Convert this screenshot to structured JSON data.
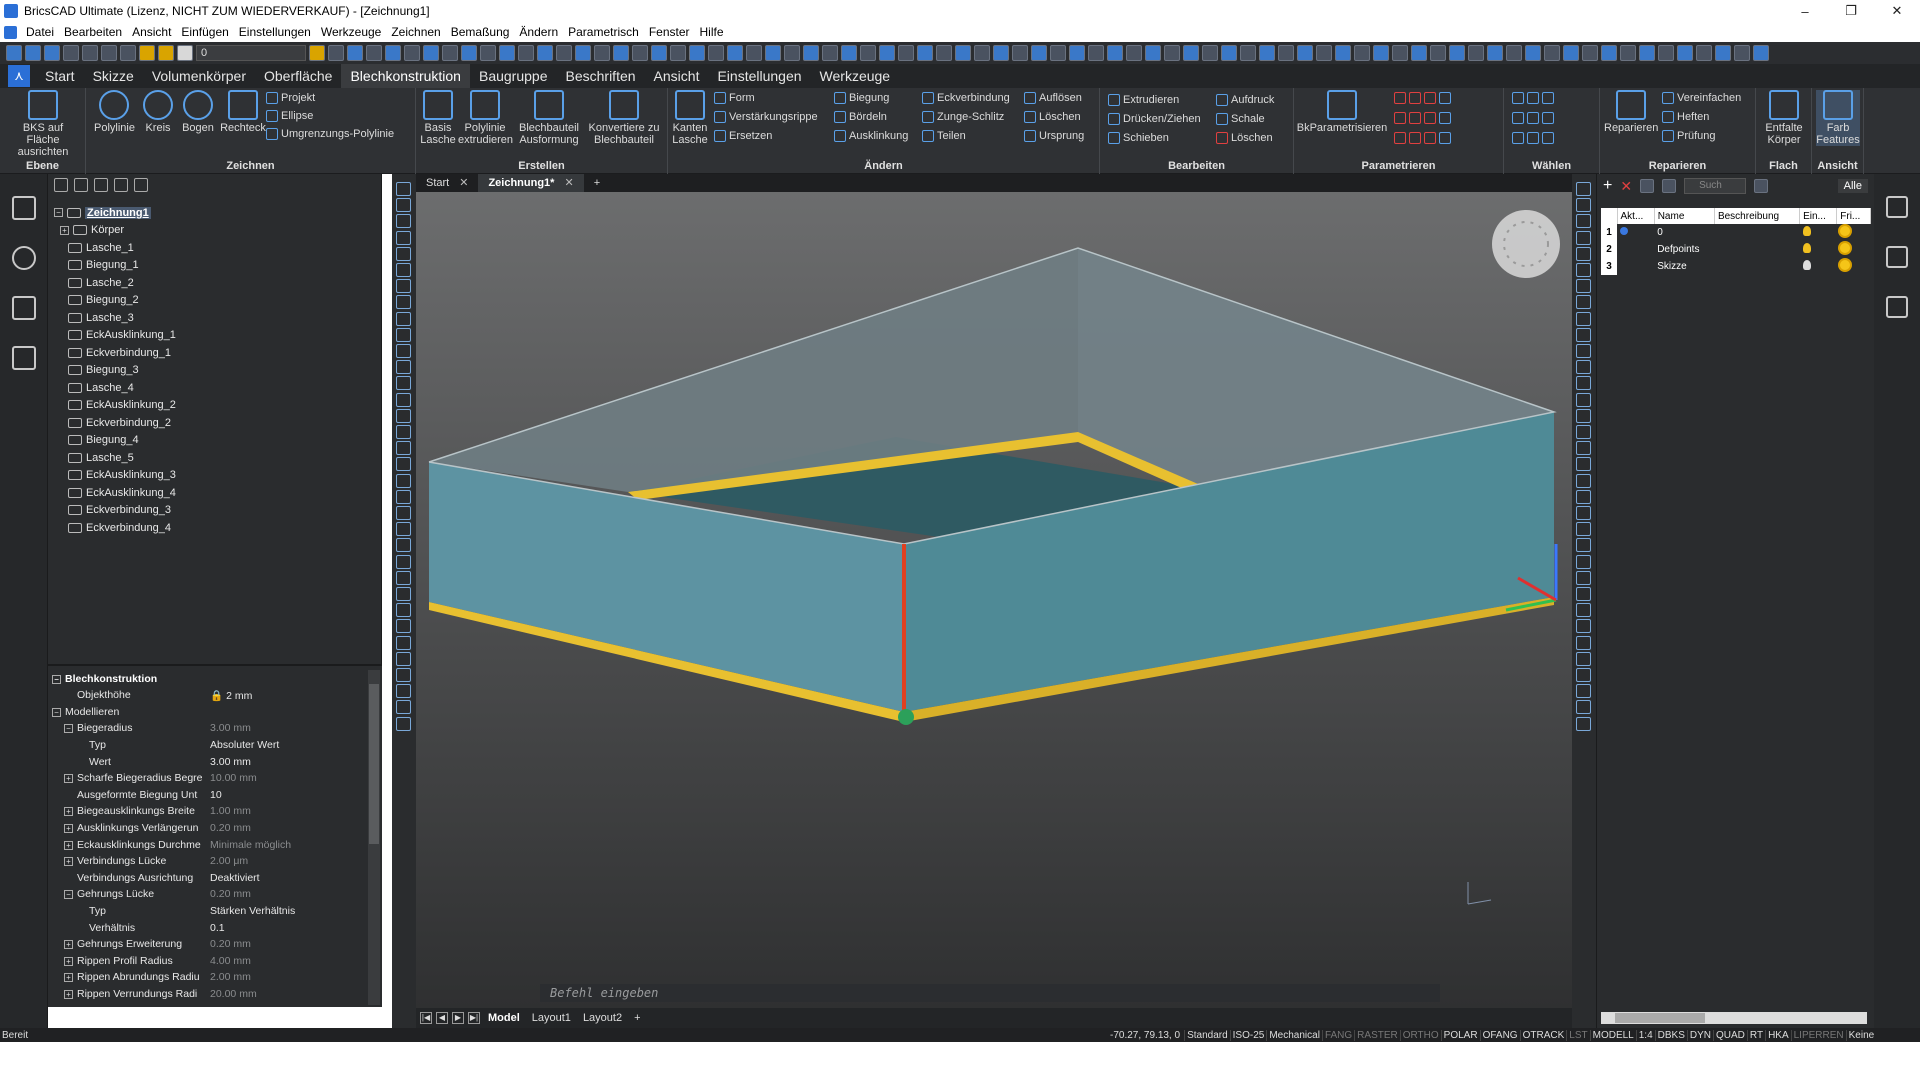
{
  "window": {
    "title": "BricsCAD Ultimate (Lizenz, NICHT ZUM WIEDERVERKAUF) - [Zeichnung1]",
    "controls": [
      "–",
      "❐",
      "✕"
    ]
  },
  "menu": [
    "Datei",
    "Bearbeiten",
    "Ansicht",
    "Einfügen",
    "Einstellungen",
    "Werkzeuge",
    "Zeichnen",
    "Bemaßung",
    "Ändern",
    "Parametrisch",
    "Fenster",
    "Hilfe"
  ],
  "quick_access": {
    "current_layer": "0"
  },
  "ribbon_tabs": [
    "Start",
    "Skizze",
    "Volumenkörper",
    "Oberfläche",
    "Blechkonstruktion",
    "Baugruppe",
    "Beschriften",
    "Ansicht",
    "Einstellungen",
    "Werkzeuge"
  ],
  "active_ribbon_tab": "Blechkonstruktion",
  "ribbon": {
    "ebene": {
      "label": "Ebene",
      "bks": "BKS auf Fläche ausrichten"
    },
    "zeichnen": {
      "label": "Zeichnen",
      "polylinie": "Polylinie",
      "kreis": "Kreis",
      "bogen": "Bogen",
      "rechteck": "Rechteck",
      "projekt": "Projekt",
      "ellipse": "Ellipse",
      "umgrenzung": "Umgrenzungs-Polylinie"
    },
    "erstellen": {
      "label": "Erstellen",
      "basis_lasche": "Basis Lasche",
      "polylinie_extrudieren": "Polylinie extrudieren",
      "blechbauteil_ausformung": "Blechbauteil Ausformung",
      "konvertiere": "Konvertiere zu Blechbauteil"
    },
    "aendern": {
      "label": "Ändern",
      "kanten_lasche": "Kanten Lasche",
      "form": "Form",
      "verstaerkungsrippe": "Verstärkungsrippe",
      "ersetzen": "Ersetzen",
      "biegung": "Biegung",
      "boerdeln": "Bördeln",
      "ausklinkung": "Ausklinkung",
      "eckverbindung": "Eckverbindung",
      "zunge_schlitz": "Zunge-Schlitz",
      "teilen": "Teilen",
      "aufloesen": "Auflösen",
      "loeschen": "Löschen",
      "ursprung": "Ursprung"
    },
    "bearbeiten": {
      "label": "Bearbeiten",
      "extrudieren": "Extrudieren",
      "druecken_ziehen": "Drücken/Ziehen",
      "schieben": "Schieben",
      "aufdruck": "Aufdruck",
      "schale": "Schale",
      "loeschen": "Löschen"
    },
    "parametrieren": {
      "label": "Parametrieren",
      "bkparametrisieren": "BkParametrisieren"
    },
    "waehlen": {
      "label": "Wählen"
    },
    "reparieren": {
      "label": "Reparieren",
      "reparieren": "Reparieren",
      "vereinfachen": "Vereinfachen",
      "heften": "Heften",
      "pruefung": "Prüfung"
    },
    "flach": {
      "label": "Flach",
      "entfalte": "Entfalte Körper"
    },
    "ansicht": {
      "label": "Ansicht",
      "farb": "Farb Features"
    }
  },
  "doc_tabs": [
    {
      "label": "Start",
      "active": false
    },
    {
      "label": "Zeichnung1*",
      "active": true
    }
  ],
  "structure_tree": {
    "root": "Zeichnung1",
    "group": "Körper",
    "items": [
      "Lasche_1",
      "Biegung_1",
      "Lasche_2",
      "Biegung_2",
      "Lasche_3",
      "EckAusklinkung_1",
      "Eckverbindung_1",
      "Biegung_3",
      "Lasche_4",
      "EckAusklinkung_2",
      "Eckverbindung_2",
      "Biegung_4",
      "Lasche_5",
      "EckAusklinkung_3",
      "EckAusklinkung_4",
      "Eckverbindung_3",
      "Eckverbindung_4"
    ]
  },
  "properties": {
    "rows": [
      {
        "key": "Blechkonstruktion",
        "value": "",
        "level": 0,
        "exp": "−",
        "head": true
      },
      {
        "key": "Objekthöhe",
        "value": "2 mm",
        "level": 1,
        "lock": true
      },
      {
        "key": "Modellieren",
        "value": "",
        "level": 0,
        "exp": "−"
      },
      {
        "key": "Biegeradius",
        "value": "3.00 mm",
        "level": 1,
        "exp": "−",
        "dim": true
      },
      {
        "key": "Typ",
        "value": "Absoluter Wert",
        "level": 2
      },
      {
        "key": "Wert",
        "value": "3.00 mm",
        "level": 2
      },
      {
        "key": "Scharfe Biegeradius Begre",
        "value": "10.00 mm",
        "level": 1,
        "exp": "+",
        "dim": true
      },
      {
        "key": "Ausgeformte Biegung Unt",
        "value": "10",
        "level": 1
      },
      {
        "key": "Biegeausklinkungs Breite",
        "value": "1.00 mm",
        "level": 1,
        "exp": "+",
        "dim": true
      },
      {
        "key": "Ausklinkungs Verlängerun",
        "value": "0.20 mm",
        "level": 1,
        "exp": "+",
        "dim": true
      },
      {
        "key": "Eckausklinkungs Durchme",
        "value": "Minimale möglich",
        "level": 1,
        "exp": "+",
        "dim": true
      },
      {
        "key": "Verbindungs Lücke",
        "value": "2.00 μm",
        "level": 1,
        "exp": "+",
        "dim": true
      },
      {
        "key": "Verbindungs Ausrichtung",
        "value": "Deaktiviert",
        "level": 1
      },
      {
        "key": "Gehrungs Lücke",
        "value": "0.20 mm",
        "level": 1,
        "exp": "−",
        "dim": true
      },
      {
        "key": "Typ",
        "value": "Stärken Verhältnis",
        "level": 2
      },
      {
        "key": "Verhältnis",
        "value": "0.1",
        "level": 2
      },
      {
        "key": "Gehrungs Erweiterung",
        "value": "0.20 mm",
        "level": 1,
        "exp": "+",
        "dim": true
      },
      {
        "key": "Rippen Profil Radius",
        "value": "4.00 mm",
        "level": 1,
        "exp": "+",
        "dim": true
      },
      {
        "key": "Rippen Abrundungs Radiu",
        "value": "2.00 mm",
        "level": 1,
        "exp": "+",
        "dim": true
      },
      {
        "key": "Rippen Verrundungs Radi",
        "value": "20.00 mm",
        "level": 1,
        "exp": "+",
        "dim": true
      }
    ]
  },
  "command_line": {
    "placeholder": "Befehl eingeben"
  },
  "layout_tabs": [
    "Model",
    "Layout1",
    "Layout2",
    "+"
  ],
  "layers": {
    "filter": "Alle",
    "search_placeholder": "Such",
    "columns": [
      "Akt...",
      "Name",
      "Beschreibung",
      "Ein...",
      "Fri..."
    ],
    "rows": [
      {
        "num": "1",
        "name": "0",
        "active": true
      },
      {
        "num": "2",
        "name": "Defpoints",
        "active": false
      },
      {
        "num": "3",
        "name": "Skizze",
        "active": false
      }
    ]
  },
  "status": {
    "ready": "Bereit",
    "coords": "-70.27, 79.13, 0",
    "fields": [
      {
        "t": "Standard",
        "on": true
      },
      {
        "t": "ISO-25",
        "on": true
      },
      {
        "t": "Mechanical",
        "on": true
      },
      {
        "t": "FANG",
        "on": false
      },
      {
        "t": "RASTER",
        "on": false
      },
      {
        "t": "ORTHO",
        "on": false
      },
      {
        "t": "POLAR",
        "on": true
      },
      {
        "t": "OFANG",
        "on": true
      },
      {
        "t": "OTRACK",
        "on": true
      },
      {
        "t": "LST",
        "on": false
      },
      {
        "t": "MODELL",
        "on": true
      },
      {
        "t": "1:4",
        "on": true
      },
      {
        "t": "DBKS",
        "on": true
      },
      {
        "t": "DYN",
        "on": true
      },
      {
        "t": "QUAD",
        "on": true
      },
      {
        "t": "RT",
        "on": true
      },
      {
        "t": "HKA",
        "on": true
      },
      {
        "t": "LIPERREN",
        "on": false
      },
      {
        "t": "Keine",
        "on": true
      }
    ]
  },
  "colors": {
    "accent": "#2b6fd6",
    "panel_face": "#4f8a96",
    "bend": "#e8c030",
    "edge_red": "#e04020",
    "viewport_top": "#6c6d6e"
  }
}
